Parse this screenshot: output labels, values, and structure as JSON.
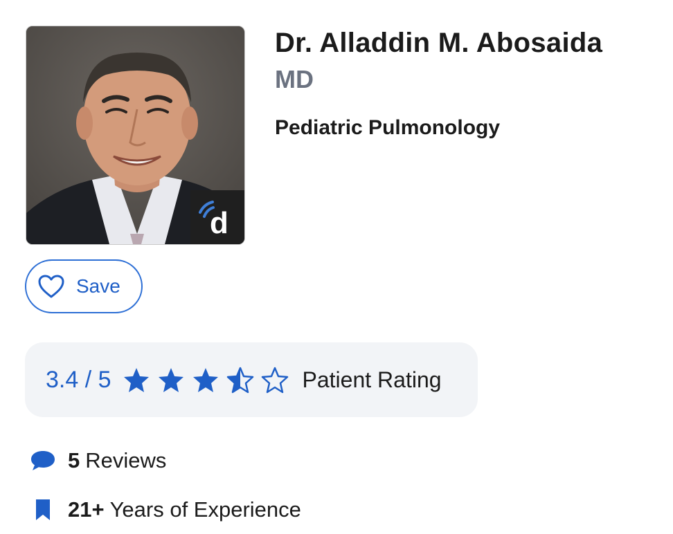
{
  "doctor": {
    "name": "Dr. Alladdin M. Abosaida",
    "credential": "MD",
    "specialty": "Pediatric Pulmonology",
    "photo_icon": "doctor-portrait-photo",
    "brand_icon": "doximity-d-logo"
  },
  "save_button": {
    "label": "Save",
    "icon": "heart-outline-icon"
  },
  "rating": {
    "value_text": "3.4 / 5",
    "value": 3.4,
    "max": 5,
    "label": "Patient Rating",
    "stars": [
      "full",
      "full",
      "full",
      "half",
      "empty"
    ]
  },
  "stats": {
    "reviews": {
      "count": "5",
      "text": "Reviews",
      "icon": "speech-bubble-icon"
    },
    "experience": {
      "count": "21+",
      "text": "Years of Experience",
      "icon": "bookmark-icon"
    }
  },
  "colors": {
    "accent": "#1f5fc7",
    "muted": "#6b7280",
    "rating_box_bg": "#f2f4f7"
  }
}
